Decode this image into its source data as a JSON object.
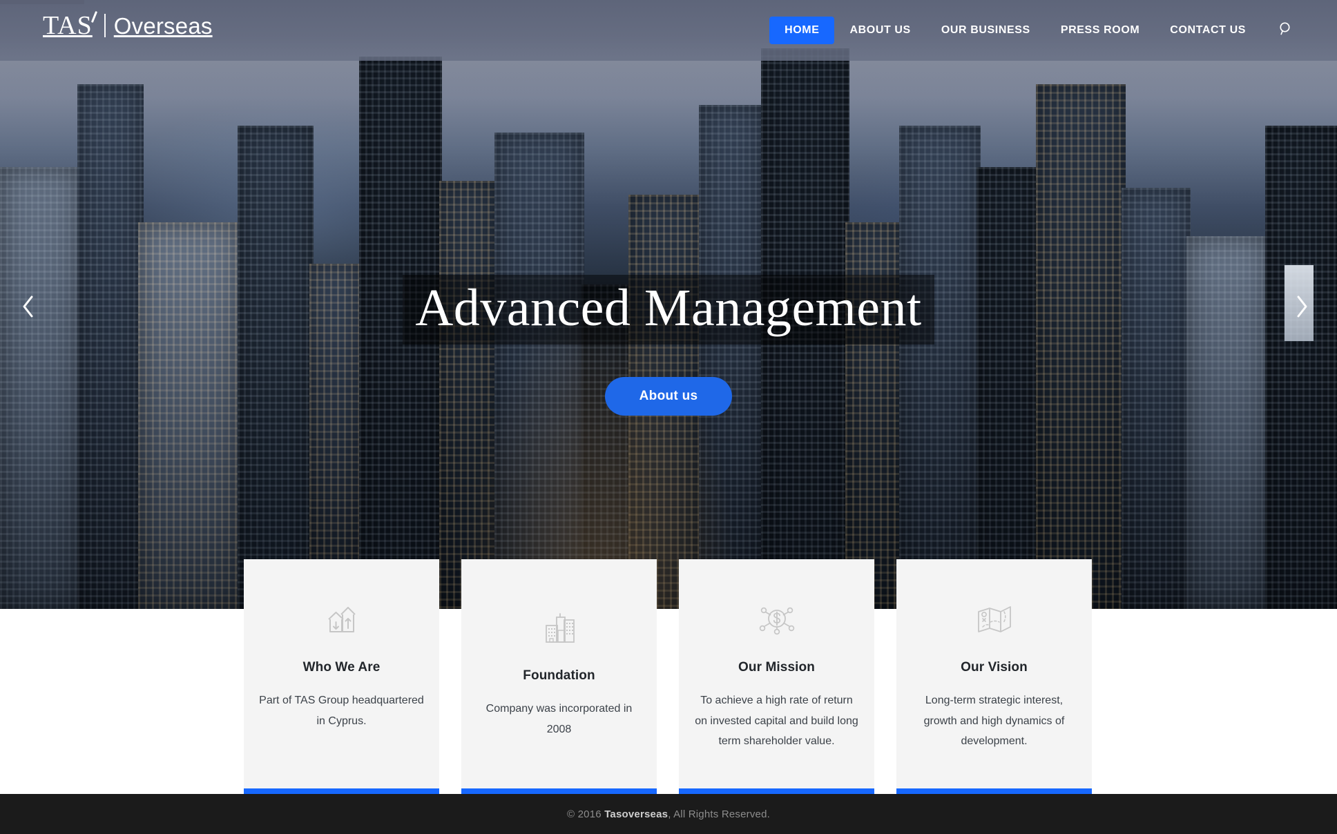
{
  "brand": {
    "mark": "TAS",
    "divider": "|",
    "name": "Overseas"
  },
  "nav": {
    "items": [
      {
        "label": "HOME",
        "active": true
      },
      {
        "label": "ABOUT US",
        "active": false
      },
      {
        "label": "OUR BUSINESS",
        "active": false
      },
      {
        "label": "PRESS ROOM",
        "active": false
      },
      {
        "label": "CONTACT US",
        "active": false
      }
    ],
    "search_icon": "search-icon"
  },
  "hero": {
    "title": "Advanced Management",
    "cta_label": "About us",
    "prev_icon": "chevron-left-icon",
    "next_icon": "chevron-right-icon"
  },
  "cards": [
    {
      "icon": "house-arrows-icon",
      "title": "Who We Are",
      "text": "Part of TAS Group headquartered in Cyprus."
    },
    {
      "icon": "buildings-icon",
      "title": "Foundation",
      "text": "Company was incorporated in 2008"
    },
    {
      "icon": "dollar-network-icon",
      "title": "Our Mission",
      "text": "To achieve a high rate of return on invested capital and build long term shareholder value."
    },
    {
      "icon": "folded-map-icon",
      "title": "Our Vision",
      "text": "Long-term strategic interest, growth and high dynamics of development."
    }
  ],
  "footer": {
    "copyright_prefix": "© 2016 ",
    "brand": "Tasoverseas",
    "copyright_suffix": ", All Rights Reserved."
  },
  "colors": {
    "accent_blue": "#1768ff",
    "cta_blue": "#1f68e8",
    "card_bg": "#f4f4f4",
    "footer_bg": "#1b1b1b",
    "header_overlay": "#5c6378"
  }
}
